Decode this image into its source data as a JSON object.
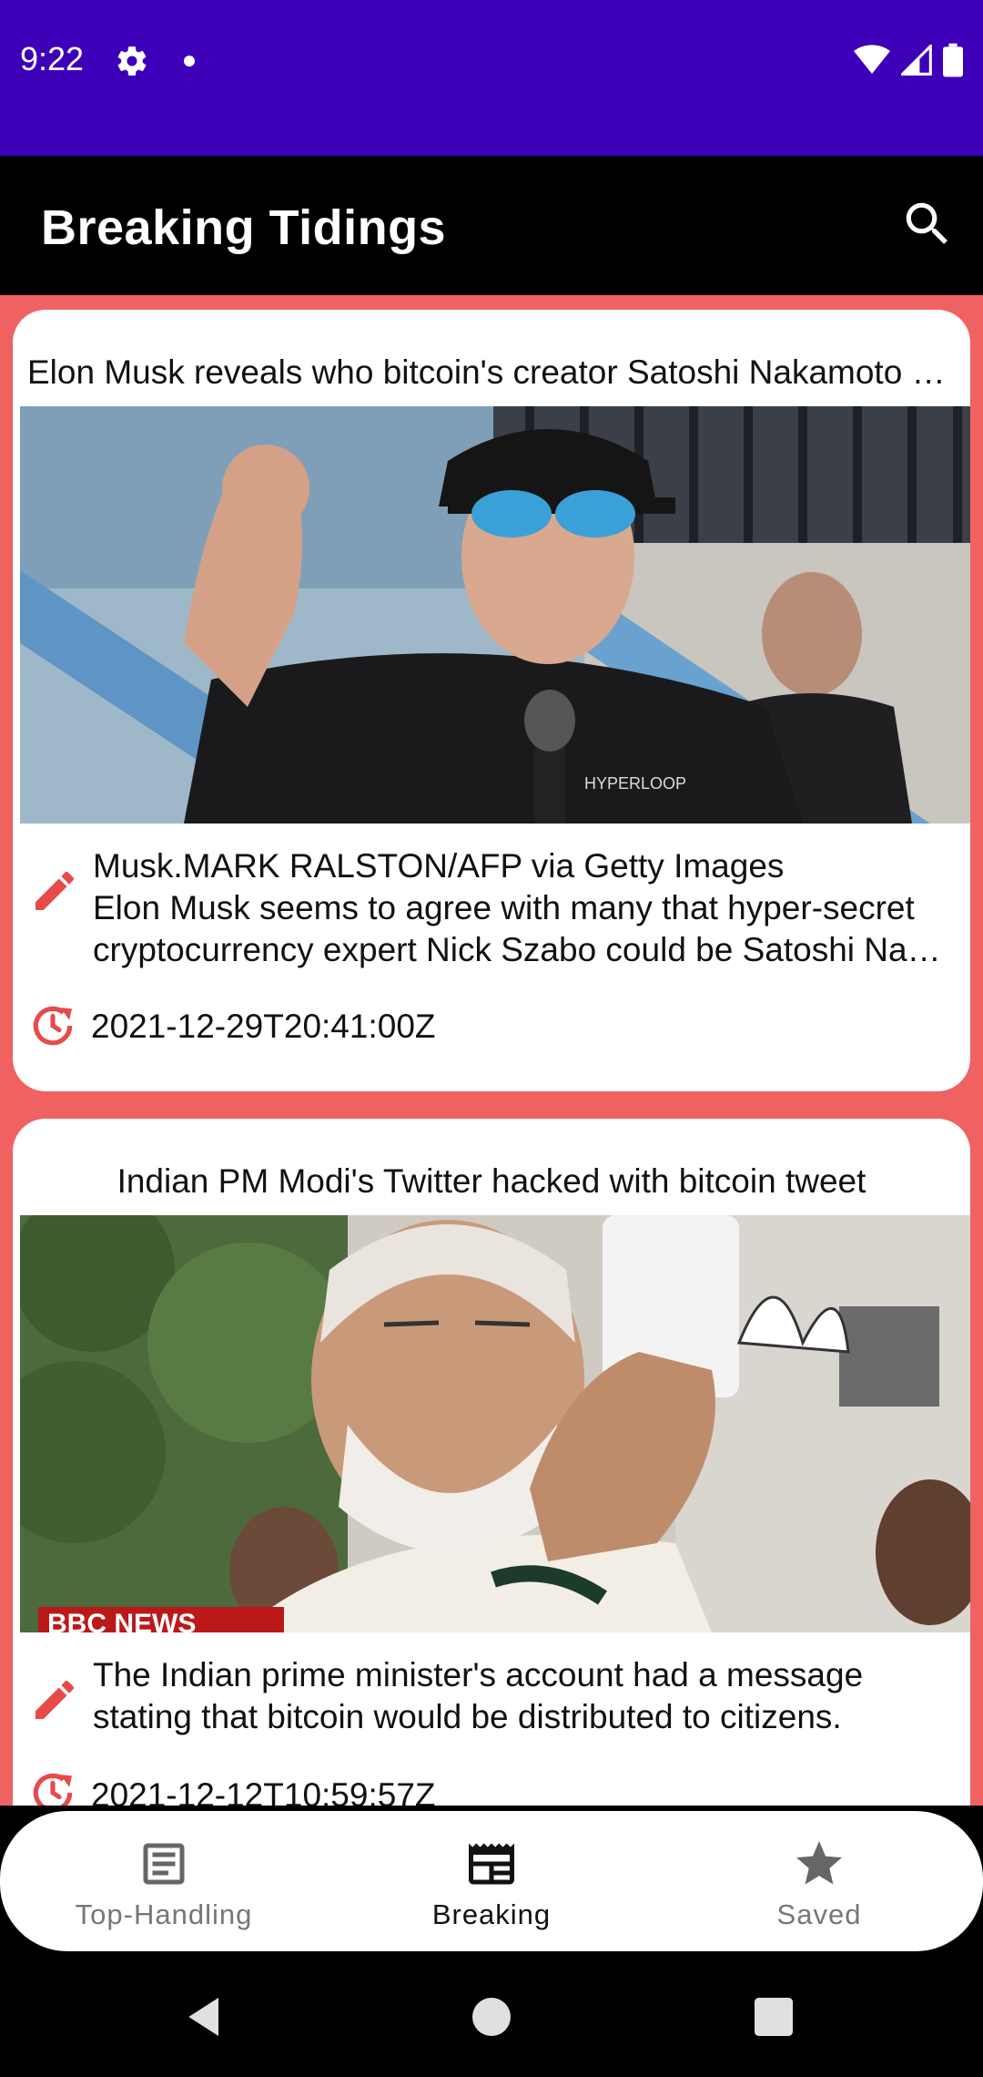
{
  "status_bar": {
    "time": "9:22",
    "color": "#3d00b8",
    "icons": [
      "settings-icon",
      "notification-dot-icon",
      "wifi-icon",
      "cellular-icon",
      "battery-icon"
    ]
  },
  "app_bar": {
    "title": "Breaking Tidings",
    "search_icon": "search-icon"
  },
  "colors": {
    "feed_background": "#f06262",
    "accent_icon": "#e84a4a",
    "app_bar": "#000000"
  },
  "articles": [
    {
      "title": "Elon Musk reveals who bitcoin's creator Satoshi Nakamoto might be",
      "image_alt": "Man in black cap and mirrored sunglasses speaking into microphone",
      "description_lines": [
        "Musk.MARK RALSTON/AFP via Getty Images",
        "Elon Musk seems to agree with many that hyper-secret",
        "cryptocurrency expert Nick Szabo could be Satoshi Nakamoto"
      ],
      "published_at": "2021-12-29T20:41:00Z"
    },
    {
      "title": "Indian PM Modi's Twitter hacked with bitcoin tweet",
      "image_alt": "Man with white beard holding phone",
      "image_badge": "BBC NEWS",
      "description_lines": [
        "The Indian prime minister's account had a message",
        "stating that bitcoin would be distributed to citizens."
      ],
      "published_at": "2021-12-12T10:59:57Z"
    }
  ],
  "bottom_nav": {
    "items": [
      {
        "label": "Top-Handling",
        "icon": "article-icon",
        "active": false
      },
      {
        "label": "Breaking",
        "icon": "newspaper-icon",
        "active": true
      },
      {
        "label": "Saved",
        "icon": "star-icon",
        "active": false
      }
    ]
  },
  "system_nav": {
    "icons": [
      "back-icon",
      "home-icon",
      "recents-icon"
    ]
  }
}
